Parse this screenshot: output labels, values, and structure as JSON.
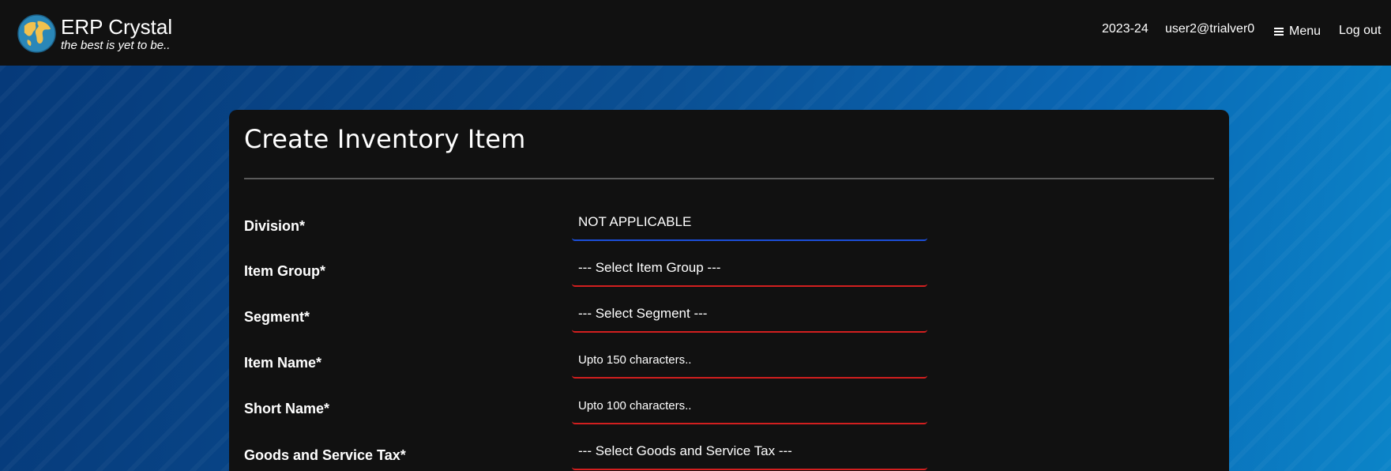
{
  "header": {
    "brand_name": "ERP Crystal",
    "brand_tagline": "the best is yet to be..",
    "year": "2023-24",
    "user": "user2@trialver0",
    "menu_label": "Menu",
    "logout_label": "Log out"
  },
  "form": {
    "title": "Create Inventory Item",
    "division": {
      "label": "Division*",
      "value": "NOT APPLICABLE"
    },
    "item_group": {
      "label": "Item Group*",
      "value": "--- Select Item Group ---"
    },
    "segment": {
      "label": "Segment*",
      "value": "--- Select Segment ---"
    },
    "item_name": {
      "label": "Item Name*",
      "placeholder": "Upto 150 characters.."
    },
    "short_name": {
      "label": "Short Name*",
      "placeholder": "Upto 100 characters.."
    },
    "gst": {
      "label": "Goods and Service Tax*",
      "value": "--- Select Goods and Service Tax ---"
    }
  },
  "colors": {
    "topbar": "#111111",
    "card": "#111111",
    "invalid_border": "#d21f1f",
    "valid_border": "#1c4fd8"
  }
}
